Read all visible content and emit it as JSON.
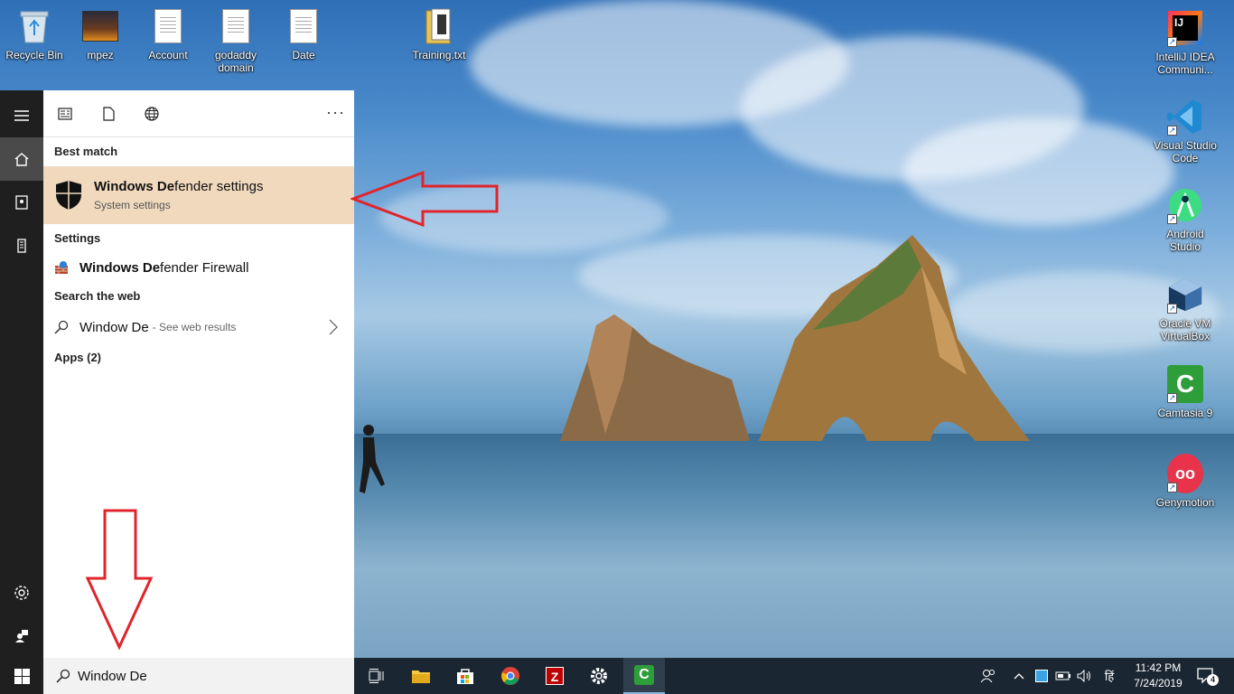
{
  "desktop": {
    "icons_left": [
      {
        "label": "Recycle Bin",
        "icon": "recycle-bin-icon"
      },
      {
        "label": "mpez",
        "icon": "image-thumbnail-icon"
      },
      {
        "label": "Account",
        "icon": "document-icon"
      },
      {
        "label": "godaddy domain",
        "icon": "document-icon"
      },
      {
        "label": "Date",
        "icon": "document-icon"
      },
      {
        "label": "Training.txt",
        "icon": "folder-document-icon"
      }
    ],
    "icons_right": [
      {
        "label": "IntelliJ IDEA Communi...",
        "icon": "intellij-icon"
      },
      {
        "label": "Visual Studio Code",
        "icon": "vscode-icon"
      },
      {
        "label": "Android Studio",
        "icon": "android-studio-icon"
      },
      {
        "label": "Oracle VM VirtualBox",
        "icon": "virtualbox-icon"
      },
      {
        "label": "Camtasia 9",
        "icon": "camtasia-icon"
      },
      {
        "label": "Genymotion",
        "icon": "genymotion-icon"
      }
    ]
  },
  "start_menu": {
    "sections": {
      "best_match": "Best match",
      "settings": "Settings",
      "search_web": "Search the web",
      "apps": "Apps (2)"
    },
    "best_match_item": {
      "title_bold": "Windows De",
      "title_rest": "fender settings",
      "subtitle": "System settings"
    },
    "settings_item": {
      "bold": "Windows De",
      "rest": "fender Firewall"
    },
    "web_item": {
      "query": "Window De",
      "hint": "- See web results"
    }
  },
  "search": {
    "value": "Window De"
  },
  "tray": {
    "time": "11:42 PM",
    "date": "7/24/2019",
    "notifications": "4",
    "ime": "हिं"
  },
  "colors": {
    "highlight": "#f1d9bd",
    "annotation_red": "#e0242c"
  }
}
